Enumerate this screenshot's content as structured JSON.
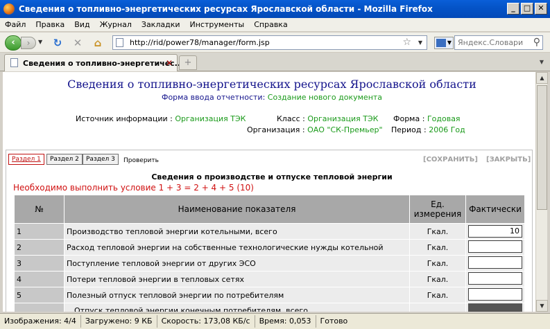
{
  "window": {
    "title": "Сведения о топливно-энергетических ресурсах Ярославской области - Mozilla Firefox",
    "min": "_",
    "max": "□",
    "close": "✕"
  },
  "menu": [
    "Файл",
    "Правка",
    "Вид",
    "Журнал",
    "Закладки",
    "Инструменты",
    "Справка"
  ],
  "nav": {
    "url": "http://rid/power78/manager/form.jsp",
    "search_placeholder": "Яндекс.Словари"
  },
  "tab": {
    "label": "Сведения о топливно-энергетичес..."
  },
  "page": {
    "title": "Сведения о топливно-энергетических ресурсах Ярославской области",
    "form_label": "Форма ввода отчетности:",
    "form_value": "Создание нового документа",
    "source_label": "Источник информации :",
    "source_value": "Организация ТЭК",
    "class_label": "Класс :",
    "class_value": "Организация ТЭК",
    "form_type_label": "Форма :",
    "form_type_value": "Годовая",
    "org_label": "Организация :",
    "org_value": "ОАО \"СК-Премьер\"",
    "period_label": "Период :",
    "period_value": "2006 Год",
    "sections": [
      "Раздел 1",
      "Раздел 2",
      "Раздел 3"
    ],
    "check": "Проверить",
    "save": "[СОХРАНИТЬ]",
    "close": "[ЗАКРЫТЬ]",
    "section_title": "Сведения о производстве и отпуске тепловой энергии",
    "condition": "Необходимо выполнить условие 1 + 3 = 2 + 4 + 5 (10)"
  },
  "table": {
    "headers": [
      "№",
      "Наименование показателя",
      "Ед. измерения",
      "Фактически"
    ],
    "rows": [
      {
        "num": "1",
        "name": "Производство тепловой энергии котельными, всего",
        "unit": "Гкал.",
        "value": "10"
      },
      {
        "num": "2",
        "name": "Расход тепловой энергии на собственные технологические нужды котельной",
        "unit": "Гкал.",
        "value": ""
      },
      {
        "num": "3",
        "name": "Поступление тепловой энергии от других ЭСО",
        "unit": "Гкал.",
        "value": ""
      },
      {
        "num": "4",
        "name": "Потери тепловой энергии в тепловых сетях",
        "unit": "Гкал.",
        "value": ""
      },
      {
        "num": "5",
        "name": "Полезный отпуск тепловой энергии по потребителям",
        "unit": "Гкал.",
        "value": ""
      },
      {
        "num": "",
        "name": "Отпуск тепловой энергии конечным потребителям, всего",
        "unit": "",
        "value": ""
      }
    ]
  },
  "status": {
    "images": "Изображения: 4/4",
    "loaded": "Загружено: 9 КБ",
    "speed": "Скорость: 173,08 КБ/с",
    "time": "Время: 0,053",
    "done": "Готово"
  }
}
